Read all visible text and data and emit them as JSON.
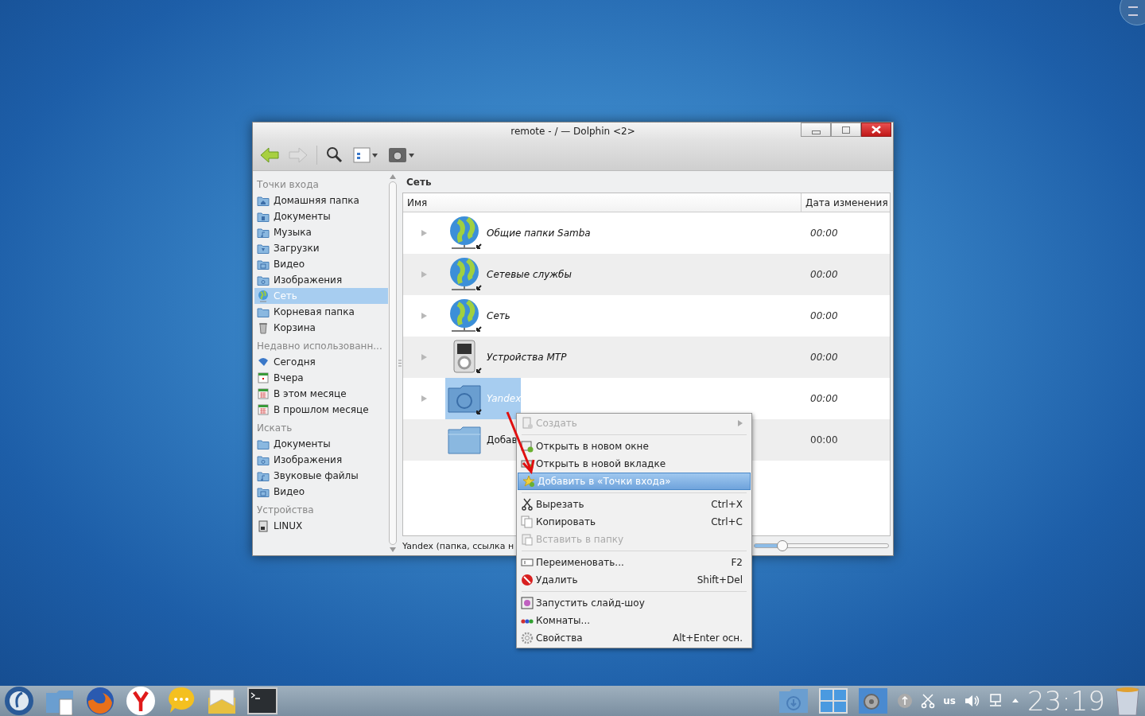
{
  "window": {
    "title": "remote - / — Dolphin <2>"
  },
  "sidebar": {
    "sections": [
      {
        "heading": "Точки входа",
        "items": [
          {
            "label": "Домашняя папка",
            "kind": "home",
            "selected": false
          },
          {
            "label": "Документы",
            "kind": "documents",
            "selected": false
          },
          {
            "label": "Музыка",
            "kind": "music",
            "selected": false
          },
          {
            "label": "Загрузки",
            "kind": "downloads",
            "selected": false
          },
          {
            "label": "Видео",
            "kind": "videos",
            "selected": false
          },
          {
            "label": "Изображения",
            "kind": "pictures",
            "selected": false
          },
          {
            "label": "Сеть",
            "kind": "network",
            "selected": true
          },
          {
            "label": "Корневая папка",
            "kind": "folder",
            "selected": false
          },
          {
            "label": "Корзина",
            "kind": "trash",
            "selected": false
          }
        ]
      },
      {
        "heading": "Недавно использованн...",
        "items": [
          {
            "label": "Сегодня",
            "kind": "today",
            "selected": false
          },
          {
            "label": "Вчера",
            "kind": "day",
            "selected": false
          },
          {
            "label": "В этом месяце",
            "kind": "month",
            "selected": false
          },
          {
            "label": "В прошлом месяце",
            "kind": "month",
            "selected": false
          }
        ]
      },
      {
        "heading": "Искать",
        "items": [
          {
            "label": "Документы",
            "kind": "folder",
            "selected": false
          },
          {
            "label": "Изображения",
            "kind": "pictures",
            "selected": false
          },
          {
            "label": "Звуковые файлы",
            "kind": "music",
            "selected": false
          },
          {
            "label": "Видео",
            "kind": "videos",
            "selected": false
          }
        ]
      },
      {
        "heading": "Устройства",
        "items": [
          {
            "label": "LINUX",
            "kind": "drive",
            "selected": false
          }
        ]
      }
    ]
  },
  "location": "Сеть",
  "table": {
    "columns": [
      "Имя",
      "Дата изменения"
    ],
    "rows": [
      {
        "name": "Общие папки Samba",
        "date": "00:00",
        "kind": "network",
        "link": true,
        "expandable": true,
        "selected": false
      },
      {
        "name": "Сетевые службы",
        "date": "00:00",
        "kind": "network",
        "link": true,
        "expandable": true,
        "selected": false
      },
      {
        "name": "Сеть",
        "date": "00:00",
        "kind": "network",
        "link": true,
        "expandable": true,
        "selected": false
      },
      {
        "name": "Устройства MTP",
        "date": "00:00",
        "kind": "device",
        "link": true,
        "expandable": true,
        "selected": false
      },
      {
        "name": "Yandex",
        "date": "00:00",
        "kind": "remote-folder",
        "link": true,
        "expandable": true,
        "selected": true
      },
      {
        "name": "Добав",
        "date": "00:00",
        "kind": "folder",
        "link": false,
        "expandable": false,
        "selected": false
      }
    ]
  },
  "status_bar": {
    "text": "Yandex (папка, ссылка н",
    "zoom": {
      "level": 0.2
    }
  },
  "context_menu": [
    {
      "kind": "item",
      "label": "Создать",
      "disabled": true,
      "selected": false,
      "submenu": true
    },
    {
      "kind": "separator"
    },
    {
      "kind": "item",
      "label": "Открыть в новом окне",
      "disabled": false,
      "selected": false,
      "submenu": false
    },
    {
      "kind": "item",
      "label": "Открыть в новой вкладке",
      "disabled": false,
      "selected": false,
      "submenu": false
    },
    {
      "kind": "item",
      "label": "Добавить в «Точки входа»",
      "disabled": false,
      "selected": true,
      "submenu": false
    },
    {
      "kind": "separator"
    },
    {
      "kind": "item",
      "label": "Вырезать",
      "shortcut": "Ctrl+X",
      "disabled": false,
      "selected": false,
      "submenu": false
    },
    {
      "kind": "item",
      "label": "Копировать",
      "shortcut": "Ctrl+C",
      "disabled": false,
      "selected": false,
      "submenu": false
    },
    {
      "kind": "item",
      "label": "Вставить в папку",
      "disabled": true,
      "selected": false,
      "submenu": false
    },
    {
      "kind": "separator"
    },
    {
      "kind": "item",
      "label": "Переименовать...",
      "shortcut": "F2",
      "disabled": false,
      "selected": false,
      "submenu": false
    },
    {
      "kind": "item",
      "label": "Удалить",
      "shortcut": "Shift+Del",
      "disabled": false,
      "selected": false,
      "submenu": false
    },
    {
      "kind": "separator"
    },
    {
      "kind": "item",
      "label": "Запустить слайд-шоу",
      "disabled": false,
      "selected": false,
      "submenu": false
    },
    {
      "kind": "item",
      "label": "Комнаты...",
      "disabled": false,
      "selected": false,
      "submenu": false
    },
    {
      "kind": "item",
      "label": "Свойства",
      "shortcut": "Alt+Enter осн.",
      "disabled": false,
      "selected": false,
      "submenu": false
    }
  ],
  "taskbar": {
    "keyboard_layout": "us",
    "clock": "23:19"
  }
}
